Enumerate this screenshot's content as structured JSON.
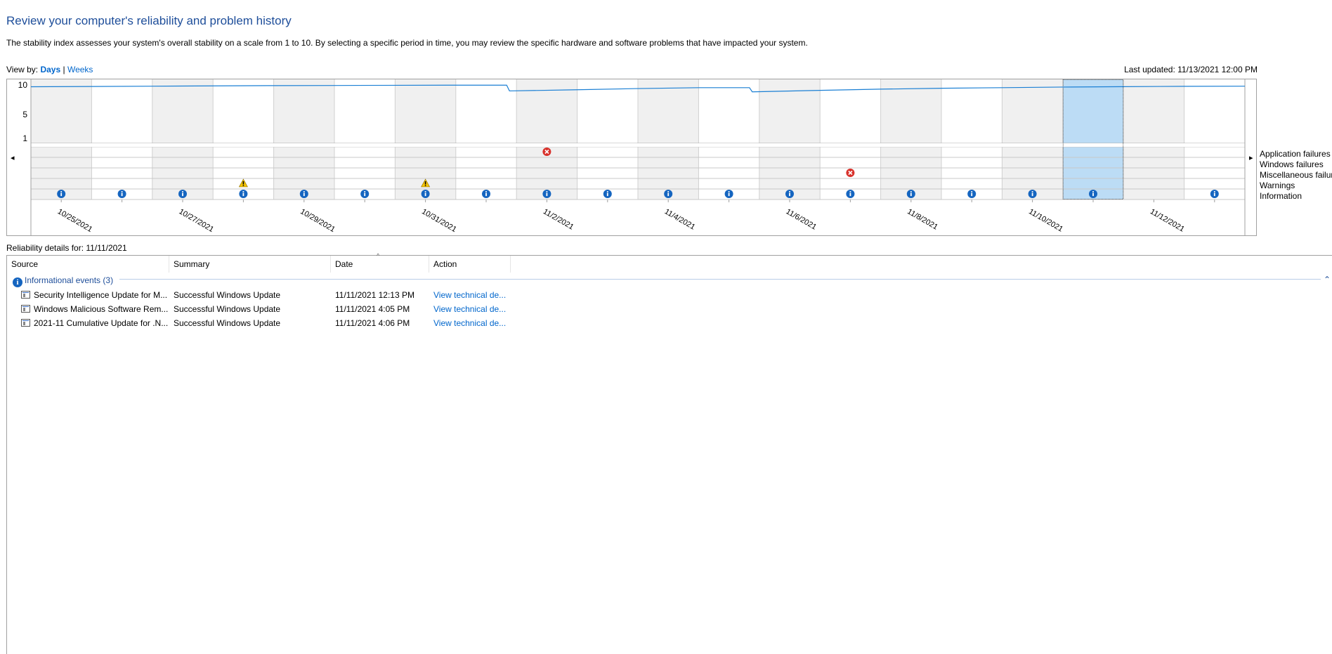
{
  "page": {
    "title": "Review your computer's reliability and problem history",
    "description": "The stability index assesses your system's overall stability on a scale from 1 to 10. By selecting a specific period in time, you may review the specific hardware and software problems that have impacted your system."
  },
  "viewby": {
    "label": "View by: ",
    "days": "Days",
    "separator": " | ",
    "weeks": "Weeks"
  },
  "last_updated": "Last updated: 11/13/2021 12:00 PM",
  "chart": {
    "left_arrow": "◂",
    "right_arrow": "▸",
    "selected_index": 17,
    "y_ticks": [
      "10",
      "5",
      "1"
    ],
    "legend": [
      "Application failures",
      "Windows failures",
      "Miscellaneous failures",
      "Warnings",
      "Information"
    ]
  },
  "chart_data": {
    "type": "line",
    "ylim": [
      1,
      10
    ],
    "y_ticks": [
      10,
      5,
      1
    ],
    "x_ticks": [
      "10/25/2021",
      "10/27/2021",
      "10/29/2021",
      "10/31/2021",
      "11/2/2021",
      "11/4/2021",
      "11/6/2021",
      "11/8/2021",
      "11/10/2021",
      "11/12/2021"
    ],
    "dates": [
      "10/25/2021",
      "10/26/2021",
      "10/27/2021",
      "10/28/2021",
      "10/29/2021",
      "10/30/2021",
      "10/31/2021",
      "11/1/2021",
      "11/2/2021",
      "11/3/2021",
      "11/4/2021",
      "11/5/2021",
      "11/6/2021",
      "11/7/2021",
      "11/8/2021",
      "11/9/2021",
      "11/10/2021",
      "11/11/2021",
      "11/12/2021",
      "11/13/2021"
    ],
    "stability": [
      9.7,
      9.75,
      9.8,
      9.85,
      9.9,
      9.92,
      9.95,
      9.97,
      9.0,
      9.2,
      9.4,
      9.55,
      8.85,
      9.1,
      9.3,
      9.45,
      9.55,
      9.65,
      9.72,
      9.78
    ],
    "application_failures": [
      0,
      0,
      0,
      0,
      0,
      0,
      0,
      0,
      1,
      0,
      0,
      0,
      0,
      0,
      0,
      0,
      0,
      0,
      0,
      0
    ],
    "windows_failures": [
      0,
      0,
      0,
      0,
      0,
      0,
      0,
      0,
      0,
      0,
      0,
      0,
      0,
      0,
      0,
      0,
      0,
      0,
      0,
      0
    ],
    "miscellaneous_failures": [
      0,
      0,
      0,
      0,
      0,
      0,
      0,
      0,
      0,
      0,
      0,
      0,
      0,
      1,
      0,
      0,
      0,
      0,
      0,
      0
    ],
    "warnings": [
      0,
      0,
      0,
      1,
      0,
      0,
      1,
      0,
      0,
      0,
      0,
      0,
      0,
      0,
      0,
      0,
      0,
      0,
      0,
      0
    ],
    "information": [
      1,
      1,
      1,
      1,
      1,
      1,
      1,
      1,
      1,
      1,
      1,
      1,
      1,
      1,
      1,
      1,
      1,
      1,
      0,
      1
    ]
  },
  "details": {
    "label": "Reliability details for: 11/11/2021",
    "columns": [
      "Source",
      "Summary",
      "Date",
      "Action"
    ],
    "group": {
      "label": "Informational events (3)",
      "icon": "info-icon",
      "chevron": "⌃"
    },
    "rows": [
      {
        "source": "Security Intelligence Update for M...",
        "summary": "Successful Windows Update",
        "date": "11/11/2021 12:13 PM",
        "action": "View technical de..."
      },
      {
        "source": "Windows Malicious Software Rem...",
        "summary": "Successful Windows Update",
        "date": "11/11/2021 4:05 PM",
        "action": "View technical de..."
      },
      {
        "source": "2021-11 Cumulative Update for .N...",
        "summary": "Successful Windows Update",
        "date": "11/11/2021 4:06 PM",
        "action": "View technical de..."
      }
    ]
  },
  "colors": {
    "title": "#1e4e9a",
    "link": "#0066cc",
    "stability_line": "#1a7fd4",
    "selected_column": "#bcdcf5",
    "shaded_column": "#f0f0f0",
    "error": "#d8322c",
    "warning": "#f6c500",
    "info": "#1565c0"
  }
}
